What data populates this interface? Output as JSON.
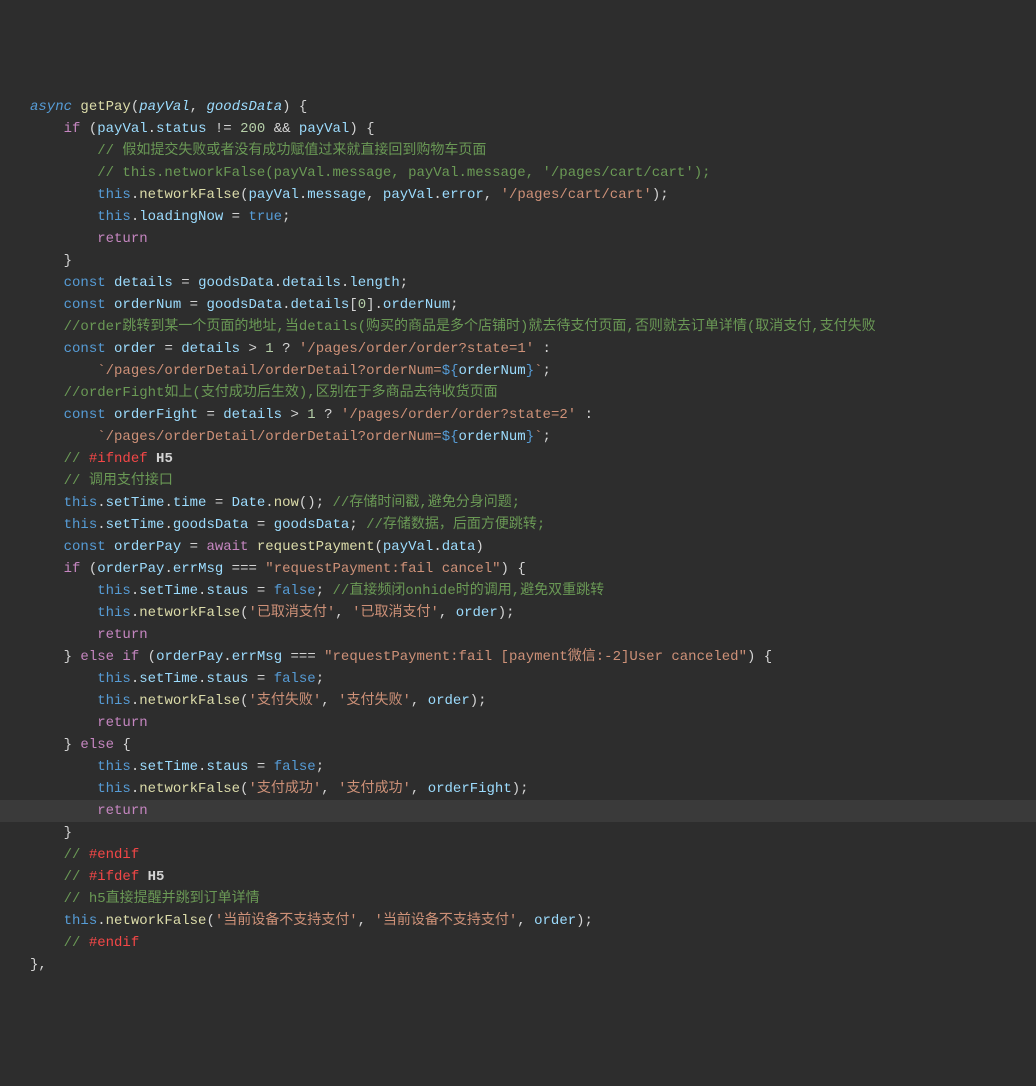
{
  "code": {
    "fn_name": "getPay",
    "params": [
      "payVal",
      "goodsData"
    ],
    "lines": {
      "l1_async": "async",
      "l1_paren_open": "(",
      "l1_comma": ", ",
      "l1_close": ") {",
      "l2_if": "if",
      "l2_cond_open": " (",
      "l2_payVal": "payVal",
      "l2_dot": ".",
      "l2_status": "status",
      "l2_neq": " != ",
      "l2_200": "200",
      "l2_and": " && ",
      "l2_payVal2": "payVal",
      "l2_close": ") {",
      "l3_comment": "// 假如提交失败或者没有成功赋值过来就直接回到购物车页面",
      "l4_comment": "// this.networkFalse(payVal.message, payVal.message, '/pages/cart/cart');",
      "l5_this": "this",
      "l5_dot": ".",
      "l5_fn": "networkFalse",
      "l5_open": "(",
      "l5_arg1a": "payVal",
      "l5_arg1b": "message",
      "l5_comma1": ", ",
      "l5_arg2a": "payVal",
      "l5_arg2b": "error",
      "l5_comma2": ", ",
      "l5_str": "'/pages/cart/cart'",
      "l5_close": ");",
      "l6_this": "this",
      "l6_prop": "loadingNow",
      "l6_eq": " = ",
      "l6_true": "true",
      "l6_semi": ";",
      "l7_return": "return",
      "l8_brace": "}",
      "l9_const": "const",
      "l9_var": " details ",
      "l9_eq": "= ",
      "l9_g": "goodsData",
      "l9_det": "details",
      "l9_len": "length",
      "l9_semi": ";",
      "l10_const": "const",
      "l10_var": " orderNum ",
      "l10_eq": "= ",
      "l10_g": "goodsData",
      "l10_det": "details",
      "l10_idx": "[",
      "l10_zero": "0",
      "l10_idx2": "].",
      "l10_on": "orderNum",
      "l10_semi": ";",
      "l11_comment": "//order跳转到某一个页面的地址,当details(购买的商品是多个店铺时)就去待支付页面,否则就去订单详情(取消支付,支付失败",
      "l12_const": "const",
      "l12_var": " order ",
      "l12_eq": "= ",
      "l12_det": "details",
      "l12_gt": " > ",
      "l12_one": "1",
      "l12_q": " ? ",
      "l12_str1": "'/pages/order/order?state=1'",
      "l12_colon": " :",
      "l13_tick1": "`/pages/orderDetail/orderDetail?orderNum=",
      "l13_dollar": "${",
      "l13_var": "orderNum",
      "l13_close": "}",
      "l13_tick2": "`",
      "l13_semi": ";",
      "l14_comment": "//orderFight如上(支付成功后生效),区别在于多商品去待收货页面",
      "l15_const": "const",
      "l15_var": " orderFight ",
      "l15_eq": "= ",
      "l15_det": "details",
      "l15_gt": " > ",
      "l15_one": "1",
      "l15_q": " ? ",
      "l15_str": "'/pages/order/order?state=2'",
      "l15_colon": " :",
      "l16_tick1": "`/pages/orderDetail/orderDetail?orderNum=",
      "l16_dollar": "${",
      "l16_var": "orderNum",
      "l16_close": "}",
      "l16_tick2": "`",
      "l16_semi": ";",
      "l17_slash": "// ",
      "l17_ifndef": "#ifndef",
      "l17_h5": " H5",
      "l18_comment": "// 调用支付接口",
      "l19_this": "this",
      "l19_st": "setTime",
      "l19_time": "time",
      "l19_eq": " = ",
      "l19_date": "Date",
      "l19_now": "now",
      "l19_call": "(); ",
      "l19_comment": "//存储时间戳,避免分身问题;",
      "l20_this": "this",
      "l20_st": "setTime",
      "l20_gd": "goodsData",
      "l20_eq": " = ",
      "l20_gd2": "goodsData",
      "l20_semi": "; ",
      "l20_comment": "//存储数据，后面方便跳转;",
      "l21_const": "const",
      "l21_var": " orderPay ",
      "l21_eq": "= ",
      "l21_await": "await",
      "l21_fn": " requestPayment",
      "l21_open": "(",
      "l21_pv": "payVal",
      "l21_data": "data",
      "l21_close": ")",
      "l22_if": "if",
      "l22_open": " (",
      "l22_op": "orderPay",
      "l22_em": "errMsg",
      "l22_eqeq": " === ",
      "l22_str": "\"requestPayment:fail cancel\"",
      "l22_close": ") {",
      "l23_this": "this",
      "l23_st": "setTime",
      "l23_staus": "staus",
      "l23_eq": " = ",
      "l23_false": "false",
      "l23_semi": "; ",
      "l23_comment": "//直接频闭onhide时的调用,避免双重跳转",
      "l24_this": "this",
      "l24_fn": "networkFalse",
      "l24_open": "(",
      "l24_s1": "'已取消支付'",
      "l24_c1": ", ",
      "l24_s2": "'已取消支付'",
      "l24_c2": ", ",
      "l24_order": "order",
      "l24_close": ");",
      "l25_return": "return",
      "l26_brace": "} ",
      "l26_else": "else",
      "l26_if": " if",
      "l26_open": " (",
      "l26_op": "orderPay",
      "l26_em": "errMsg",
      "l26_eqeq": " === ",
      "l26_str": "\"requestPayment:fail [payment微信:-2]User canceled\"",
      "l26_close": ") {",
      "l27_this": "this",
      "l27_st": "setTime",
      "l27_staus": "staus",
      "l27_eq": " = ",
      "l27_false": "false",
      "l27_semi": ";",
      "l28_this": "this",
      "l28_fn": "networkFalse",
      "l28_open": "(",
      "l28_s1": "'支付失败'",
      "l28_c1": ", ",
      "l28_s2": "'支付失败'",
      "l28_c2": ", ",
      "l28_order": "order",
      "l28_close": ");",
      "l29_return": "return",
      "l30_brace": "} ",
      "l30_else": "else",
      "l30_open": " {",
      "l31_this": "this",
      "l31_st": "setTime",
      "l31_staus": "staus",
      "l31_eq": " = ",
      "l31_false": "false",
      "l31_semi": ";",
      "l32_this": "this",
      "l32_fn": "networkFalse",
      "l32_open": "(",
      "l32_s1": "'支付成功'",
      "l32_c1": ", ",
      "l32_s2": "'支付成功'",
      "l32_c2": ", ",
      "l32_of": "orderFight",
      "l32_close": ");",
      "l33_return": "return",
      "l34_brace": "}",
      "l35_slash": "// ",
      "l35_endif": "#endif",
      "l36_slash": "// ",
      "l36_ifdef": "#ifdef",
      "l36_h5": " H5",
      "l37_comment": "// h5直接提醒并跳到订单详情",
      "l38_this": "this",
      "l38_fn": "networkFalse",
      "l38_open": "(",
      "l38_s1": "'当前设备不支持支付'",
      "l38_c1": ", ",
      "l38_s2": "'当前设备不支持支付'",
      "l38_c2": ", ",
      "l38_order": "order",
      "l38_close": ");",
      "l39_slash": "// ",
      "l39_endif": "#endif",
      "l40_brace": "},"
    }
  }
}
